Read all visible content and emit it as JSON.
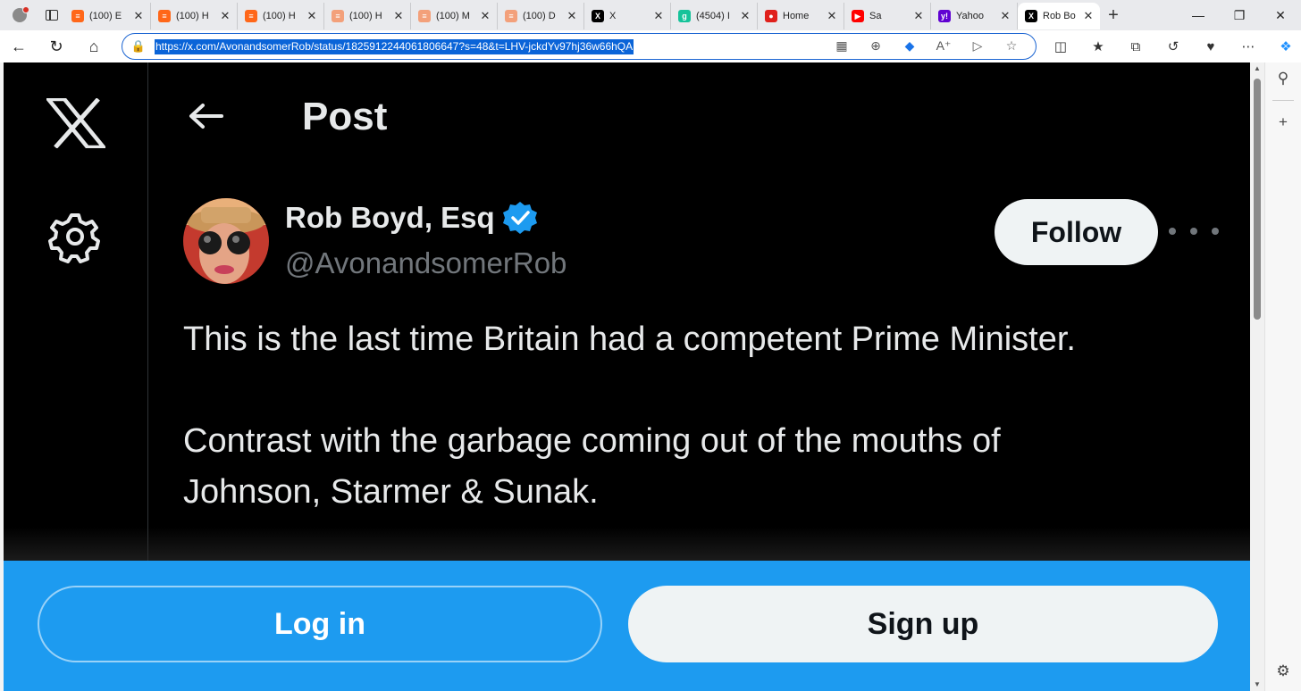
{
  "browser": {
    "tabs": [
      {
        "title": "(100) E",
        "favicon": "substack-icon",
        "color": "#ff6719"
      },
      {
        "title": "(100) H",
        "favicon": "substack-icon",
        "color": "#ff6719"
      },
      {
        "title": "(100) H",
        "favicon": "substack-icon",
        "color": "#ff6719"
      },
      {
        "title": "(100) H",
        "favicon": "substack-icon",
        "color": "#f3a07a"
      },
      {
        "title": "(100) M",
        "favicon": "substack-icon",
        "color": "#f3a07a"
      },
      {
        "title": "(100) D",
        "favicon": "substack-icon",
        "color": "#f3a07a"
      },
      {
        "title": "X",
        "favicon": "x-icon",
        "color": "#000000"
      },
      {
        "title": "(4504) I",
        "favicon": "g-icon",
        "color": "#15c39a"
      },
      {
        "title": "Home",
        "favicon": "microphone-icon",
        "color": "#e0201b"
      },
      {
        "title": "Sa",
        "favicon": "youtube-icon",
        "color": "#ff0000"
      },
      {
        "title": "Yahoo",
        "favicon": "yahoo-icon",
        "color": "#6001d2"
      },
      {
        "title": "Rob Bo",
        "favicon": "x-icon",
        "color": "#000000",
        "active": true
      }
    ],
    "url": "https://x.com/AvonandsomerRob/status/1825912244061806647?s=48&t=LHV-jckdYv97hj36w66hQA"
  },
  "page": {
    "header_title": "Post",
    "author": {
      "name": "Rob Boyd, Esq",
      "handle": "@AvonandsomerRob",
      "verified": true
    },
    "follow_label": "Follow",
    "tweet": {
      "line1": "This is the last time Britain had a competent Prime Minister.",
      "line2": "Contrast with the garbage coming out of the mouths of\nJohnson, Starmer & Sunak."
    }
  },
  "login_bar": {
    "login_label": "Log in",
    "signup_label": "Sign up"
  },
  "colors": {
    "accent": "#1d9bf0",
    "background": "#000000",
    "text": "#e7e9ea",
    "muted": "#71767b"
  }
}
